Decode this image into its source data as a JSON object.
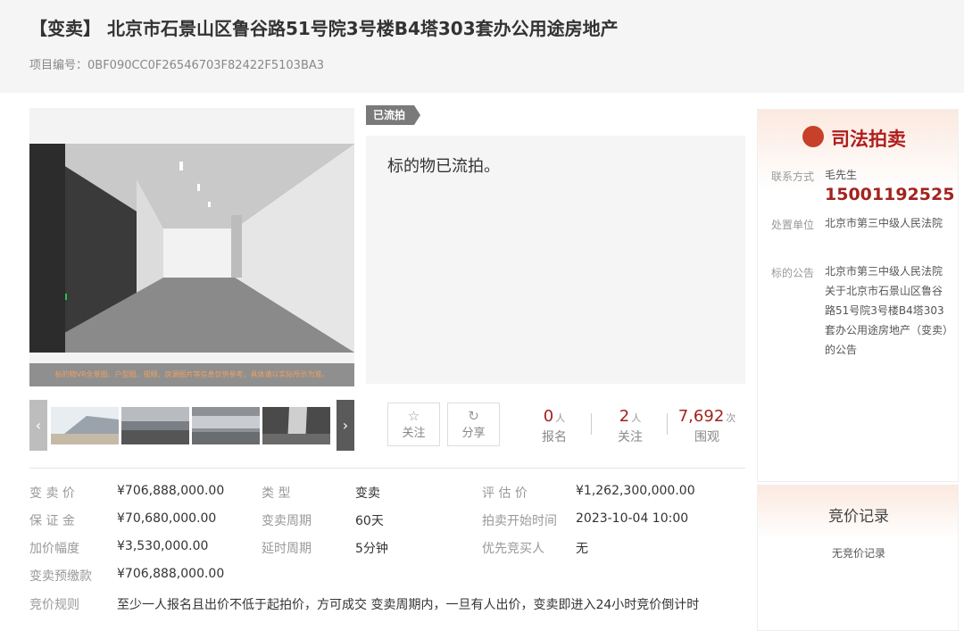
{
  "header": {
    "title": "【变卖】 北京市石景山区鲁谷路51号院3号楼B4塔303套办公用途房地产",
    "project_id": "项目编号：0BF090CC0F26546703F82422F5103BA3"
  },
  "gallery": {
    "note": "标的物VR全景图、户型图、视频、房源图片等信息仅供参考，具体请以实际所示为准。",
    "prev_icon": "chevron-left-icon",
    "next_icon": "chevron-right-icon"
  },
  "status": {
    "tag": "已流拍",
    "message": "标的物已流拍。"
  },
  "actions": {
    "follow_label": "关注",
    "share_label": "分享"
  },
  "stats": [
    {
      "num": "0",
      "unit": "人",
      "label": "报名"
    },
    {
      "num": "2",
      "unit": "人",
      "label": "关注"
    },
    {
      "num": "7,692",
      "unit": "次",
      "label": "围观"
    }
  ],
  "info": {
    "sale_price_label": "变 卖 价",
    "sale_price": "¥706,888,000.00",
    "type_label": "类    型",
    "type": "变卖",
    "appraisal_label": "评 估 价",
    "appraisal": "¥1,262,300,000.00",
    "deposit_label": "保 证 金",
    "deposit": "¥70,680,000.00",
    "period_label": "变卖周期",
    "period": "60天",
    "start_label": "拍卖开始时间",
    "start": "2023-10-04 10:00",
    "increment_label": "加价幅度",
    "increment": "¥3,530,000.00",
    "delay_label": "延时周期",
    "delay": "5分钟",
    "priority_label": "优先竞买人",
    "priority": "无",
    "prepay_label": "变卖预缴款",
    "prepay": "¥706,888,000.00",
    "rules_label": "竞价规则",
    "rules": "至少一人报名且出价不低于起拍价，方可成交 变卖周期内，一旦有人出价，变卖即进入24小时竞价倒计时"
  },
  "side": {
    "title": "司法拍卖",
    "contact_label": "联系方式",
    "contact_name": "毛先生",
    "phone": "15001192525",
    "unit_label": "处置单位",
    "unit": "北京市第三中级人民法院",
    "notice_label": "标的公告",
    "notice": "北京市第三中级人民法院关于北京市石景山区鲁谷路51号院3号楼B4塔303套办公用途房地产（变卖）的公告"
  },
  "bids": {
    "title": "竞价记录",
    "empty": "无竞价记录"
  }
}
